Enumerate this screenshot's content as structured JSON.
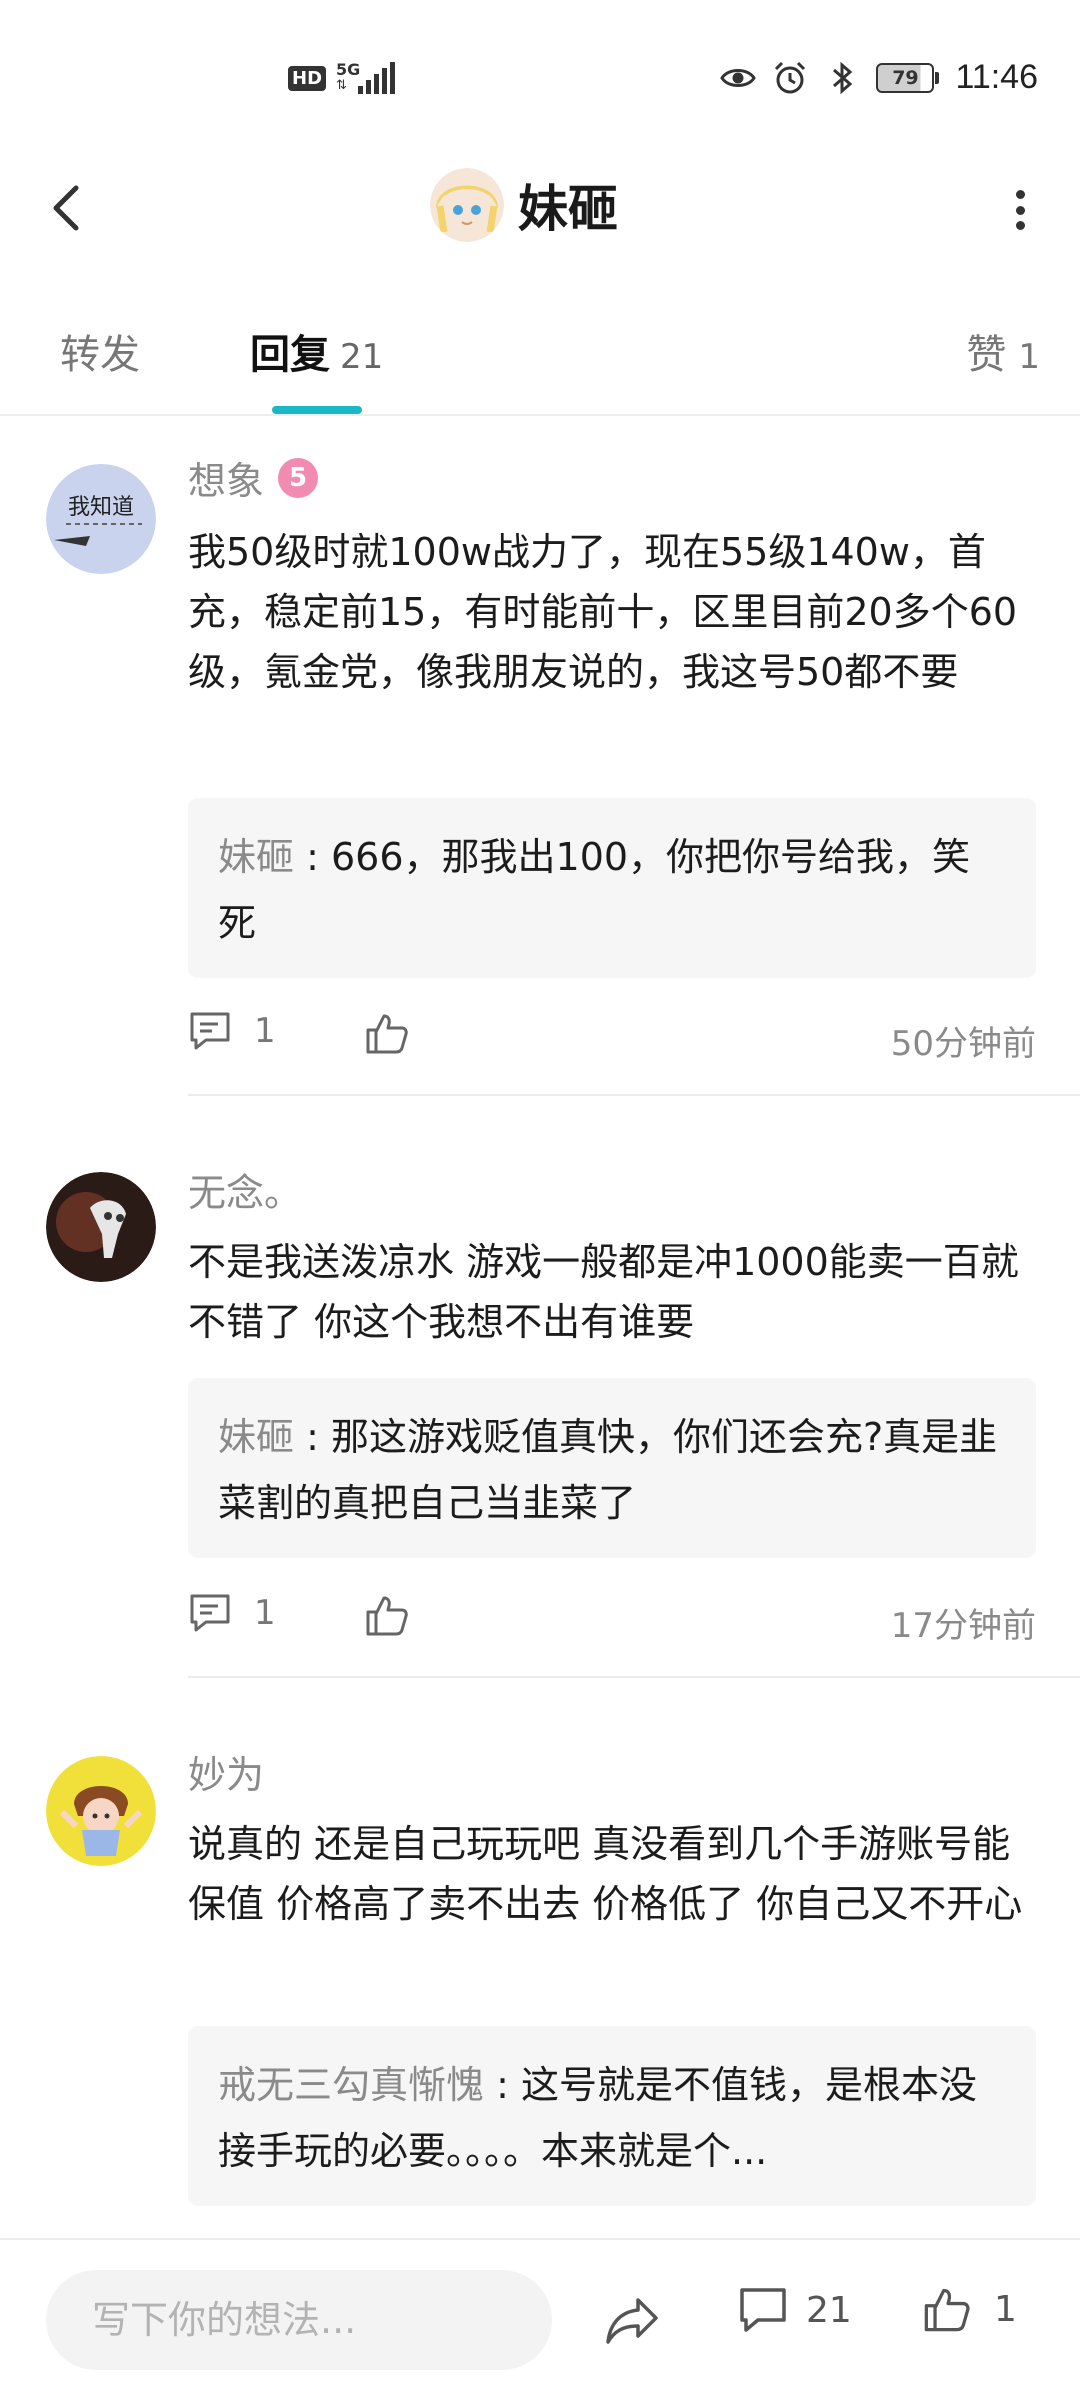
{
  "status_bar": {
    "hd_label": "HD",
    "network_label": "5G",
    "battery_level": "79",
    "time": "11:46"
  },
  "header": {
    "title": "妹砸"
  },
  "tabs": {
    "forward_label": "转发",
    "reply_label": "回复",
    "reply_count": "21",
    "like_label": "赞",
    "like_count": "1"
  },
  "comments": [
    {
      "username": "想象",
      "level": "5",
      "text": "我50级时就100w战力了，现在55级140w，首充，稳定前15，有时能前十，区里目前20多个60级，氪金党，像我朋友说的，我这号50都不要",
      "sub_author": "妹砸",
      "sub_text": "666，那我出100，你把你号给我，笑死",
      "reply_count": "1",
      "time": "50分钟前",
      "avatar_text": "我知道"
    },
    {
      "username": "无念。",
      "text": "不是我送泼凉水 游戏一般都是冲1000能卖一百就不错了 你这个我想不出有谁要",
      "sub_author": "妹砸",
      "sub_text": "那这游戏贬值真快，你们还会充?真是韭菜割的真把自己当韭菜了",
      "reply_count": "1",
      "time": "17分钟前"
    },
    {
      "username": "妙为",
      "text": "说真的 还是自己玩玩吧 真没看到几个手游账号能保值 价格高了卖不出去 价格低了 你自己又不开心",
      "sub_author": "戒无三勾真惭愧",
      "sub_text": "这号就是不值钱，是根本没接手玩的必要。。。。本来就是个..."
    }
  ],
  "bottom_bar": {
    "input_placeholder": "写下你的想法...",
    "comment_count": "21",
    "like_count": "1"
  },
  "colors": {
    "accent": "#1ab8c2",
    "level_badge": "#f28bb0",
    "subreply_bg": "#f6f6f6"
  }
}
